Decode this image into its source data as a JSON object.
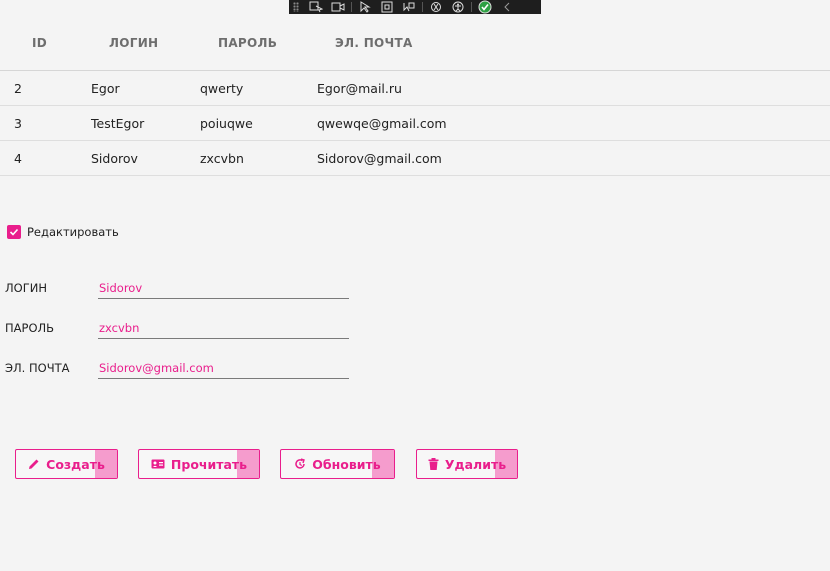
{
  "table": {
    "headers": [
      "ID",
      "ЛОГИН",
      "ПАРОЛЬ",
      "ЭЛ. ПОЧТА"
    ],
    "rows": [
      {
        "id": "2",
        "login": "Egor",
        "password": "qwerty",
        "email": "Egor@mail.ru"
      },
      {
        "id": "3",
        "login": "TestEgor",
        "password": "poiuqwe",
        "email": "qwewqe@gmail.com"
      },
      {
        "id": "4",
        "login": "Sidorov",
        "password": "zxcvbn",
        "email": "Sidorov@gmail.com"
      }
    ]
  },
  "edit_checkbox": {
    "label": "Редактировать",
    "checked": true
  },
  "form": {
    "login": {
      "label": "ЛОГИН",
      "value": "Sidorov"
    },
    "password": {
      "label": "ПАРОЛЬ",
      "value": "zxcvbn"
    },
    "email": {
      "label": "ЭЛ. ПОЧТА",
      "value": "Sidorov@gmail.com"
    }
  },
  "buttons": {
    "create": {
      "label": "Создать",
      "icon": "pencil-icon"
    },
    "read": {
      "label": "Прочитать",
      "icon": "id-card-icon"
    },
    "update": {
      "label": "Обновить",
      "icon": "refresh-icon"
    },
    "delete": {
      "label": "Удалить",
      "icon": "trash-icon"
    }
  },
  "colors": {
    "accent": "#e91e8c",
    "accent_light": "#f59ccd",
    "background": "#f4f4f4"
  }
}
